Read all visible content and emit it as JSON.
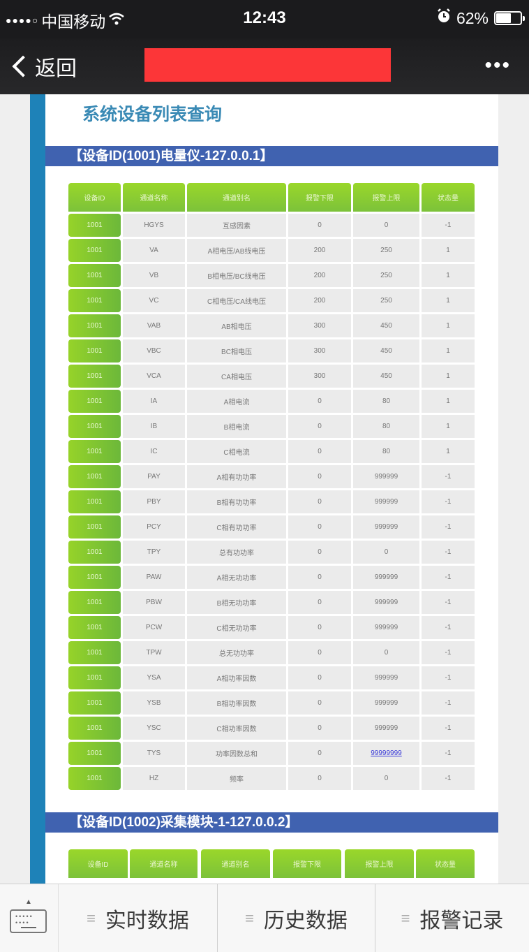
{
  "status_bar": {
    "signal": "●●●●○",
    "carrier": "中国移动",
    "wifi_icon": "wifi-icon",
    "time": "12:43",
    "alarm_icon": "alarm-clock-icon",
    "battery_percent": "62%",
    "battery_level": 0.62
  },
  "nav": {
    "back_label": "返回",
    "title_redacted": true,
    "more_label": "•••"
  },
  "page": {
    "title": "系统设备列表查询"
  },
  "devices": [
    {
      "heading": "【设备ID(1001)电量仪-127.0.0.1】",
      "columns": [
        "设备ID",
        "通道名称",
        "通道别名",
        "报警下限",
        "报警上限",
        "状态量"
      ],
      "rows": [
        [
          "1001",
          "HGYS",
          "互感因素",
          "0",
          "0",
          "-1"
        ],
        [
          "1001",
          "VA",
          "A相电压/AB线电压",
          "200",
          "250",
          "1"
        ],
        [
          "1001",
          "VB",
          "B相电压/BC线电压",
          "200",
          "250",
          "1"
        ],
        [
          "1001",
          "VC",
          "C相电压/CA线电压",
          "200",
          "250",
          "1"
        ],
        [
          "1001",
          "VAB",
          "AB相电压",
          "300",
          "450",
          "1"
        ],
        [
          "1001",
          "VBC",
          "BC相电压",
          "300",
          "450",
          "1"
        ],
        [
          "1001",
          "VCA",
          "CA相电压",
          "300",
          "450",
          "1"
        ],
        [
          "1001",
          "IA",
          "A相电流",
          "0",
          "80",
          "1"
        ],
        [
          "1001",
          "IB",
          "B相电流",
          "0",
          "80",
          "1"
        ],
        [
          "1001",
          "IC",
          "C相电流",
          "0",
          "80",
          "1"
        ],
        [
          "1001",
          "PAY",
          "A相有功功率",
          "0",
          "999999",
          "-1"
        ],
        [
          "1001",
          "PBY",
          "B相有功功率",
          "0",
          "999999",
          "-1"
        ],
        [
          "1001",
          "PCY",
          "C相有功功率",
          "0",
          "999999",
          "-1"
        ],
        [
          "1001",
          "TPY",
          "总有功功率",
          "0",
          "0",
          "-1"
        ],
        [
          "1001",
          "PAW",
          "A相无功功率",
          "0",
          "999999",
          "-1"
        ],
        [
          "1001",
          "PBW",
          "B相无功功率",
          "0",
          "999999",
          "-1"
        ],
        [
          "1001",
          "PCW",
          "C相无功功率",
          "0",
          "999999",
          "-1"
        ],
        [
          "1001",
          "TPW",
          "总无功功率",
          "0",
          "0",
          "-1"
        ],
        [
          "1001",
          "YSA",
          "A相功率因数",
          "0",
          "999999",
          "-1"
        ],
        [
          "1001",
          "YSB",
          "B相功率因数",
          "0",
          "999999",
          "-1"
        ],
        [
          "1001",
          "YSC",
          "C相功率因数",
          "0",
          "999999",
          "-1"
        ],
        [
          "1001",
          "TYS",
          "功率因数总和",
          "0",
          "99999999",
          "-1"
        ],
        [
          "1001",
          "HZ",
          "频率",
          "0",
          "0",
          "-1"
        ]
      ],
      "link_cell": {
        "row": 21,
        "col": 4
      }
    },
    {
      "heading": "【设备ID(1002)采集模块-1-127.0.0.2】",
      "columns": [
        "设备ID",
        "通道名称",
        "通道别名",
        "报警下限",
        "报警上限",
        "状态量"
      ],
      "rows": []
    }
  ],
  "tabbar": {
    "keyboard_icon": "keyboard-icon",
    "tabs": [
      {
        "label": "实时数据",
        "icon": "menu-icon"
      },
      {
        "label": "历史数据",
        "icon": "menu-icon"
      },
      {
        "label": "报警记录",
        "icon": "menu-icon"
      }
    ]
  },
  "colors": {
    "accent_blue": "#1e82b8",
    "section_bar": "#4062b0",
    "header_green": "#8ccc30",
    "title_blue": "#3a8ab5",
    "redaction": "#fc3638",
    "link": "#3a3bd8"
  }
}
